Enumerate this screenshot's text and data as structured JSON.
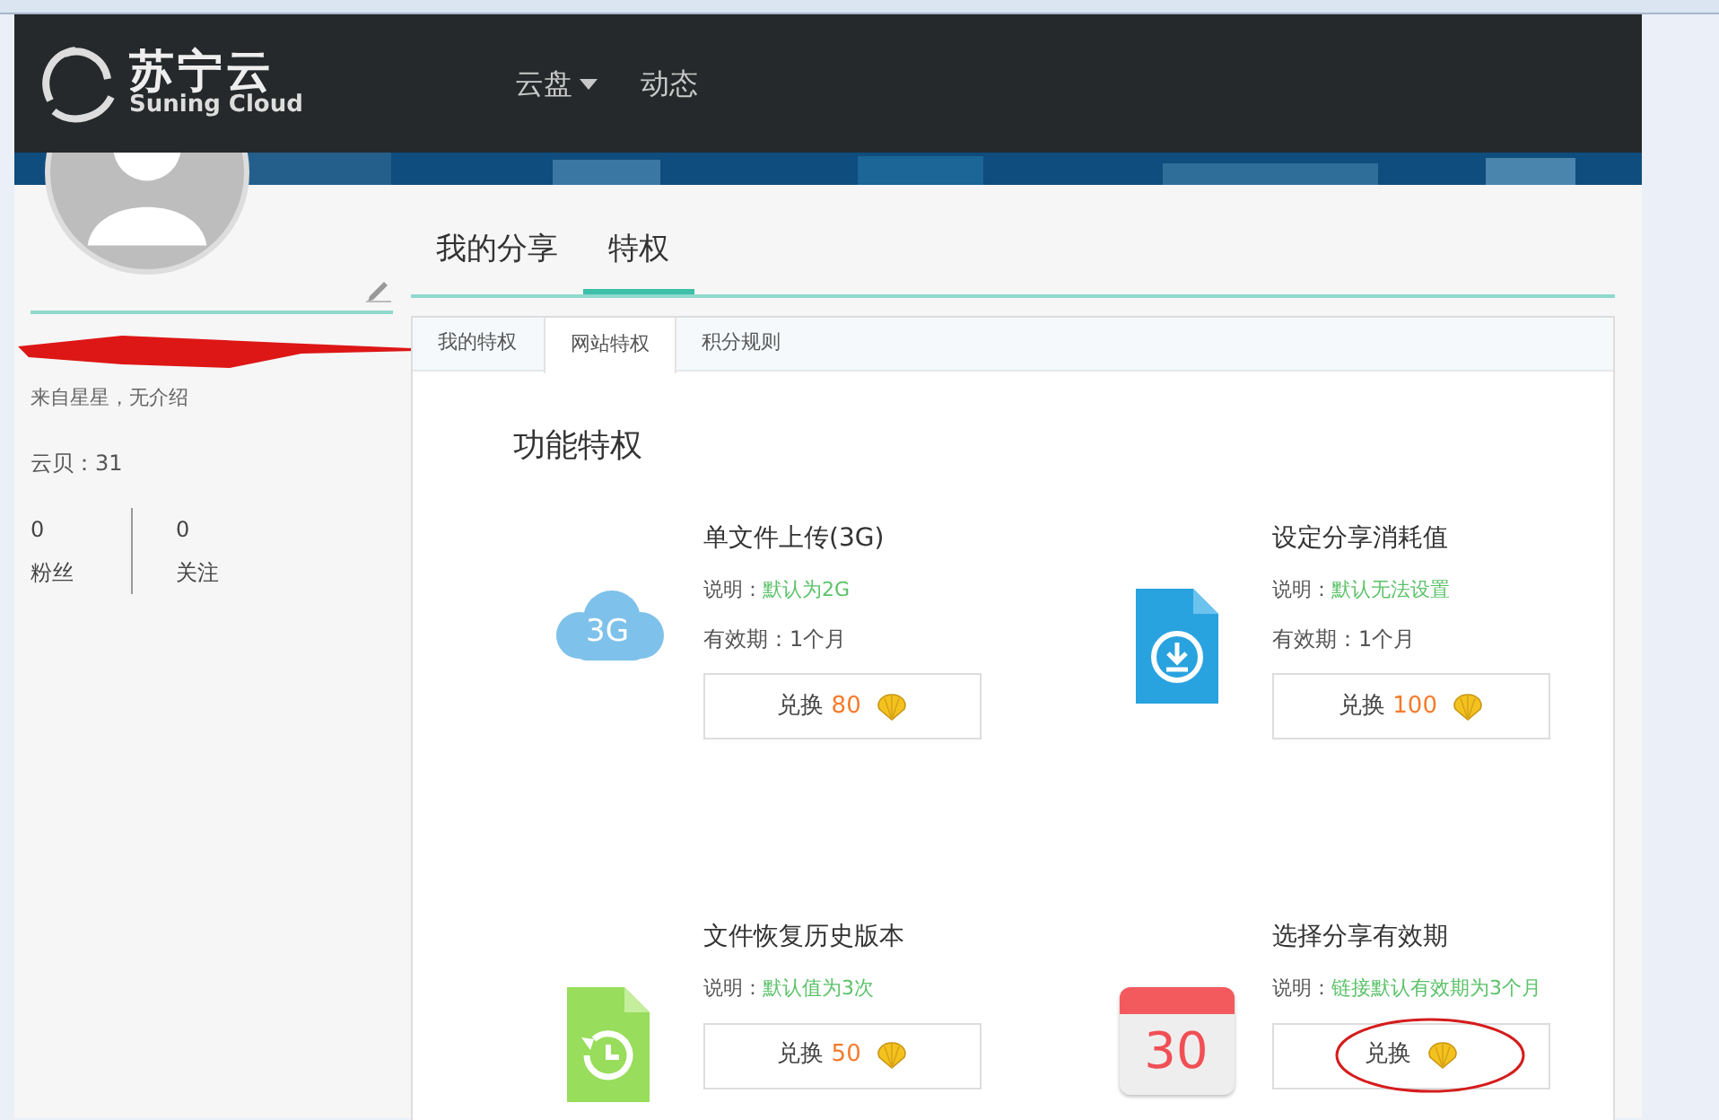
{
  "navbar": {
    "logo_cn": "苏宁云",
    "logo_en": "Suning Cloud",
    "links": [
      {
        "label": "云盘",
        "dropdown": true
      },
      {
        "label": "动态",
        "dropdown": false
      }
    ]
  },
  "profile": {
    "bio": "来自星星，无介绍",
    "coins": "云贝：31",
    "stats": [
      {
        "value": "0",
        "label": "粉丝"
      },
      {
        "value": "0",
        "label": "关注"
      }
    ]
  },
  "main_tabs": [
    {
      "label": "我的分享",
      "selected": false
    },
    {
      "label": "特权",
      "selected": true
    }
  ],
  "sub_tabs": [
    {
      "label": "我的特权",
      "selected": false
    },
    {
      "label": "网站特权",
      "selected": true
    },
    {
      "label": "积分规则",
      "selected": false
    }
  ],
  "section_title": "功能特权",
  "privileges": [
    {
      "kind": "cloud",
      "icon_text": "3G",
      "title": "单文件上传(3G)",
      "note_label": "说明：",
      "note": "默认为2G",
      "validity": "有效期：1个月",
      "button_label": "兑换",
      "price": "80"
    },
    {
      "kind": "download-file",
      "title": "设定分享消耗值",
      "note_label": "说明：",
      "note": "默认无法设置",
      "validity": "有效期：1个月",
      "button_label": "兑换",
      "price": "100"
    },
    {
      "kind": "history-file",
      "title": "文件恢复历史版本",
      "note_label": "说明：",
      "note": "默认值为3次",
      "button_label": "兑换",
      "price": "50"
    },
    {
      "kind": "calendar",
      "icon_text": "30",
      "title": "选择分享有效期",
      "note_label": "说明：",
      "note": "链接默认有效期为3个月",
      "button_label": "兑换"
    }
  ]
}
